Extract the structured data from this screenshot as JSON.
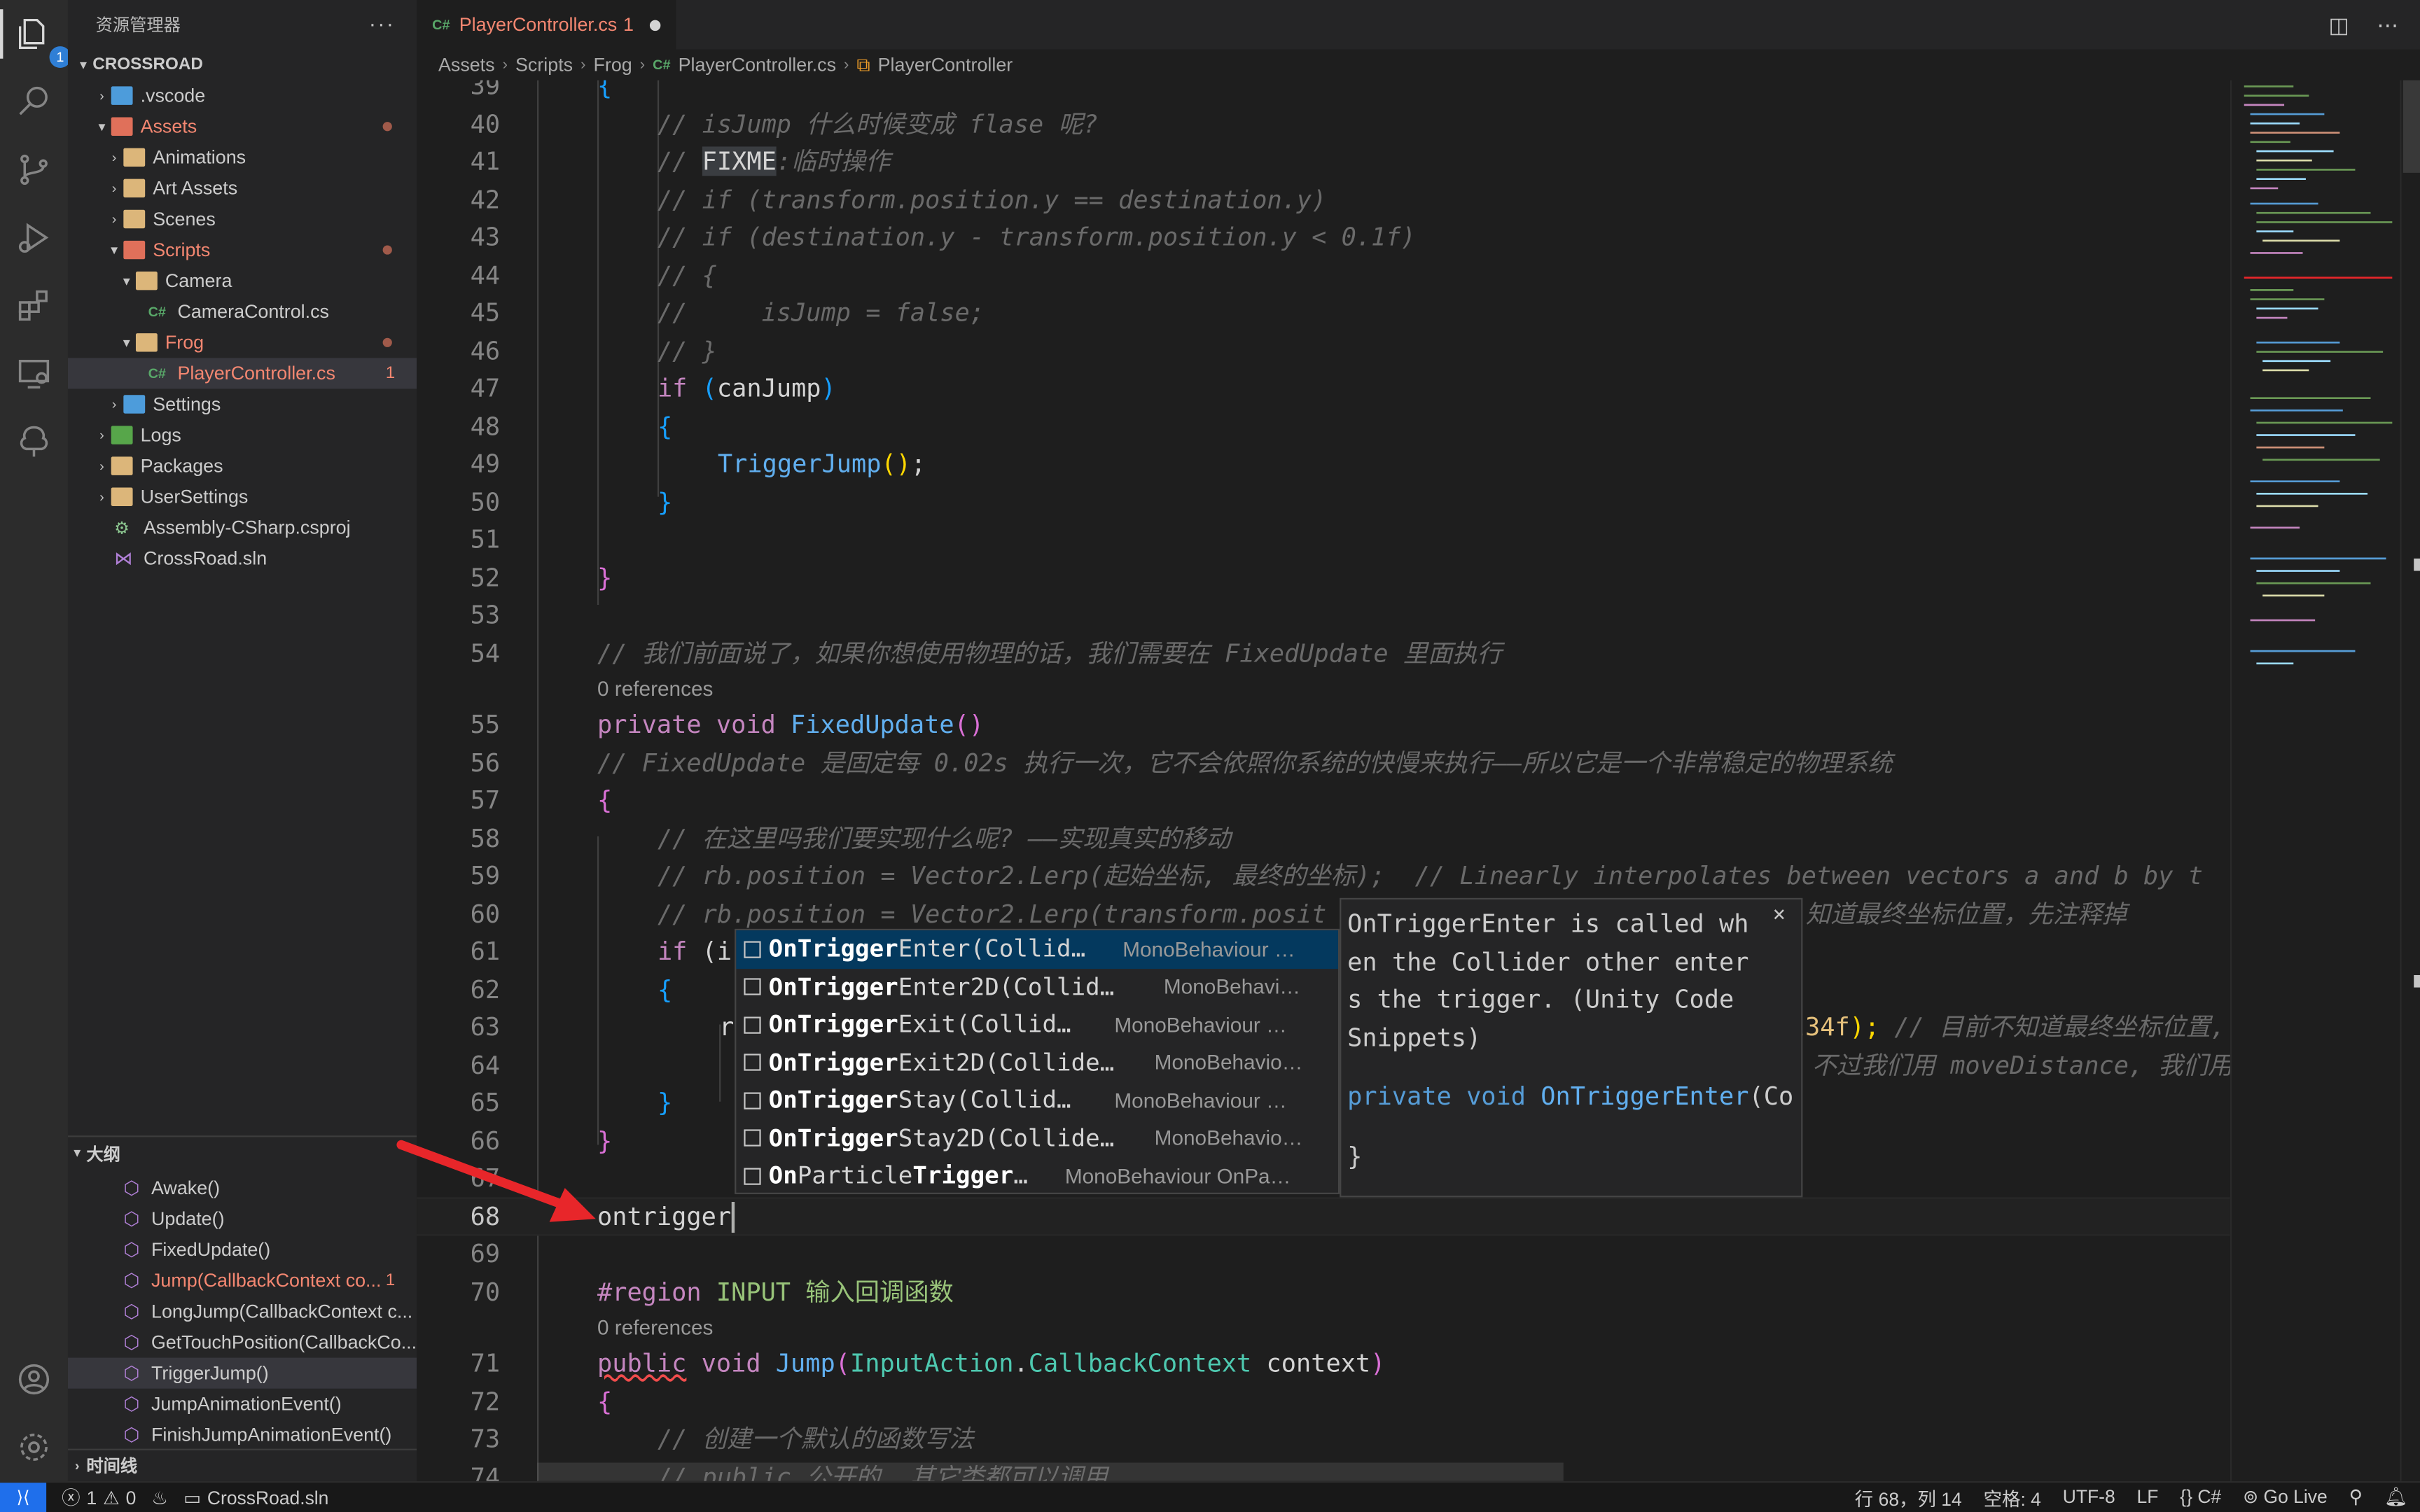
{
  "explorer": {
    "title": "资源管理器",
    "more": "···",
    "root": "CROSSROAD",
    "items": [
      {
        "label": ".vscode",
        "depth": 1,
        "icon": "folder-vscode-icon"
      },
      {
        "label": "Assets",
        "depth": 1,
        "icon": "folder-assets-icon"
      },
      {
        "label": "Animations",
        "depth": 2,
        "icon": "folder-icon"
      },
      {
        "label": "Art Assets",
        "depth": 2,
        "icon": "folder-icon"
      },
      {
        "label": "Scenes",
        "depth": 2,
        "icon": "folder-icon"
      },
      {
        "label": "Scripts",
        "depth": 2,
        "icon": "folder-scripts-icon"
      },
      {
        "label": "Camera",
        "depth": 3,
        "icon": "folder-icon"
      },
      {
        "label": "CameraControl.cs",
        "depth": 4,
        "icon": "csharp-file-icon"
      },
      {
        "label": "Frog",
        "depth": 3,
        "icon": "folder-icon"
      },
      {
        "label": "PlayerController.cs",
        "depth": 4,
        "icon": "csharp-file-icon",
        "badge": "1"
      },
      {
        "label": "Settings",
        "depth": 2,
        "icon": "folder-settings-icon"
      },
      {
        "label": "Logs",
        "depth": 1,
        "icon": "folder-logs-icon"
      },
      {
        "label": "Packages",
        "depth": 1,
        "icon": "folder-packages-icon"
      },
      {
        "label": "UserSettings",
        "depth": 1,
        "icon": "folder-icon"
      },
      {
        "label": "Assembly-CSharp.csproj",
        "depth": 1,
        "icon": "csproj-icon"
      },
      {
        "label": "CrossRoad.sln",
        "depth": 1,
        "icon": "sln-icon"
      }
    ]
  },
  "outline": {
    "title": "大纲",
    "items": [
      {
        "label": "Awake()"
      },
      {
        "label": "Update()"
      },
      {
        "label": "FixedUpdate()"
      },
      {
        "label": "Jump(CallbackContext co...",
        "badge": "1"
      },
      {
        "label": "LongJump(CallbackContext c..."
      },
      {
        "label": "GetTouchPosition(CallbackCo..."
      },
      {
        "label": "TriggerJump()"
      },
      {
        "label": "JumpAnimationEvent()"
      },
      {
        "label": "FinishJumpAnimationEvent()"
      }
    ]
  },
  "timeline": {
    "title": "时间线"
  },
  "tab": {
    "cs_tag": "C#",
    "filename": "PlayerController.cs",
    "problems": "1"
  },
  "breadcrumb": [
    "Assets",
    "Scripts",
    "Frog",
    "PlayerController.cs",
    "PlayerController"
  ],
  "breadcrumb_cs": "C#",
  "editor": {
    "lines": {
      "l39": "39",
      "l40": "40",
      "l41": "41",
      "l42": "42",
      "l43": "43",
      "l44": "44",
      "l45": "45",
      "l46": "46",
      "l47": "47",
      "l48": "48",
      "l49": "49",
      "l50": "50",
      "l51": "51",
      "l52": "52",
      "l53": "53",
      "l54": "54",
      "l55": "55",
      "l56": "56",
      "l57": "57",
      "l58": "58",
      "l59": "59",
      "l60": "60",
      "l61": "61",
      "l62": "62",
      "l63": "63",
      "l64": "64",
      "l65": "65",
      "l66": "66",
      "l67": "67",
      "l68": "68",
      "l69": "69",
      "l70": "70",
      "l71": "71",
      "l72": "72",
      "l73": "73",
      "l74": "74"
    },
    "code": {
      "c39": "{",
      "c40": "// isJump 什么时候变成 flase 呢?",
      "c41a": "// ",
      "c41b": "FIXME",
      "c41c": ":临时操作",
      "c42": "// if (transform.position.y == destination.y)",
      "c43": "// if (destination.y - transform.position.y < 0.1f)",
      "c44": "// {",
      "c45": "//     isJump = false;",
      "c46": "// }",
      "c47a": "if",
      "c47b": "(",
      "c47c": "canJump",
      "c47d": ")",
      "c48": "{",
      "c49a": "TriggerJump",
      "c49b": "()",
      "c49c": ";",
      "c50": "}",
      "c52": "}",
      "c54": "// 我们前面说了，如果你想使用物理的话，我们需要在 FixedUpdate 里面执行",
      "lens55": "0 references",
      "c55a": "private",
      "c55b": "void",
      "c55c": "FixedUpdate",
      "c55d": "()",
      "c56": "// FixedUpdate 是固定每 0.02s 执行一次，它不会依照你系统的快慢来执行——所以它是一个非常稳定的物理系统",
      "c57": "{",
      "c58": "// 在这里吗我们要实现什么呢? ——实现真实的移动",
      "c59": "// rb.position = Vector2.Lerp(起始坐标, 最终的坐标);  // Linearly interpolates between vectors a and b by t",
      "c60a": "// rb.position = Vector2.Lerp(transform.posit",
      "c60b": "知道最终坐标位置，先注释掉",
      "c61a": "if",
      "c61b": " (i",
      "c62": "{",
      "c63a": "r",
      "c63b": "l34f",
      "c63c": ");",
      "c63d": " // 目前不知道最终坐标位置,",
      "c64": "不过我们用 moveDistance, 我们用",
      "c65": "}",
      "c66": "}",
      "c67": "",
      "c68": "ontrigger",
      "c70a": "#region",
      "c70b": "INPUT 输入回调函数",
      "lens71": "0 references",
      "c71a": "public",
      "c71b": "void",
      "c71c": "Jump",
      "c71d": "(",
      "c71e": "InputAction",
      "c71f": ".",
      "c71g": "CallbackContext",
      "c71h": "context",
      "c71i": ")",
      "c72": "{",
      "c73": "// 创建一个默认的函数写法",
      "c74": "// public 公开的, 其它类都可以调用"
    }
  },
  "suggest": {
    "items": [
      {
        "match": "OnTrigger",
        "rest": "Enter(Collid…",
        "detail": "MonoBehaviour …"
      },
      {
        "match": "OnTrigger",
        "rest": "Enter2D(Collid…",
        "detail": "MonoBehavi…"
      },
      {
        "match": "OnTrigger",
        "rest": "Exit(Collid…",
        "detail": "MonoBehaviour …"
      },
      {
        "match": "OnTrigger",
        "rest": "Exit2D(Collide…",
        "detail": "MonoBehavio…"
      },
      {
        "match": "OnTrigger",
        "rest": "Stay(Collid…",
        "detail": "MonoBehaviour …"
      },
      {
        "match": "OnTrigger",
        "rest": "Stay2D(Collide…",
        "detail": "MonoBehavio…"
      },
      {
        "match": "On",
        "mid": "Particle",
        "match2": "Trigger",
        "rest": "…",
        "detail": "MonoBehaviour OnPa…"
      }
    ],
    "doc": {
      "description": "OnTriggerEnter is called wh\nen the Collider other enter\ns the trigger. (Unity Code\nSnippets)",
      "sig_a": "private",
      "sig_b": "void",
      "sig_c": "OnTriggerEnter",
      "sig_d": "(Co",
      "sig_close": "}",
      "close": "×"
    }
  },
  "status": {
    "errors": "1",
    "warnings": "0",
    "solution": "CrossRoad.sln",
    "position": "行 68，列 14",
    "spaces": "空格: 4",
    "encoding": "UTF-8",
    "eol": "LF",
    "language": "C#",
    "golive": "Go Live"
  },
  "activity": {
    "badge": "1"
  },
  "colors": {
    "accent": "#1f6feb",
    "error": "#f48771",
    "arrow": "#e8262a"
  }
}
